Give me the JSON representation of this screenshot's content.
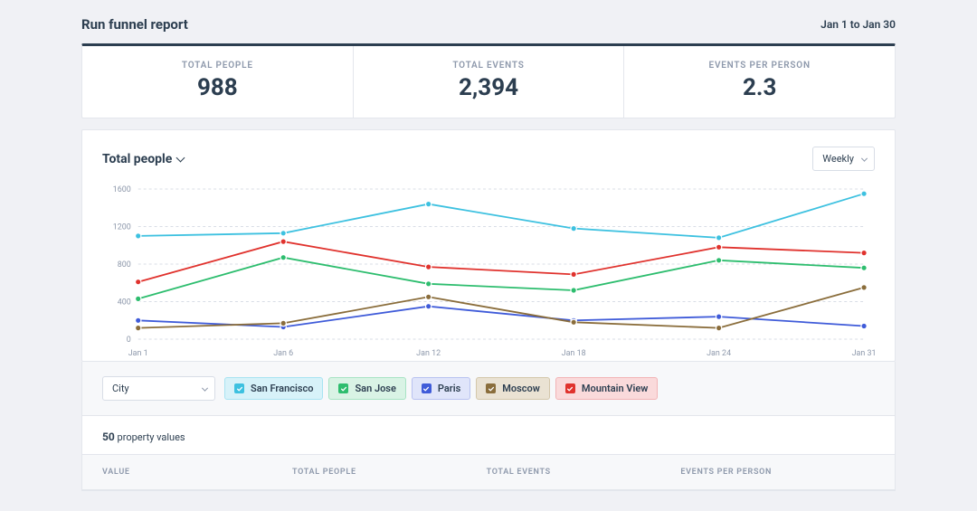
{
  "header": {
    "title": "Run funnel report",
    "date_range": "Jan 1 to Jan 30"
  },
  "stats": [
    {
      "label": "TOTAL PEOPLE",
      "value": "988"
    },
    {
      "label": "TOTAL EVENTS",
      "value": "2,394"
    },
    {
      "label": "EVENTS PER PERSON",
      "value": "2.3"
    }
  ],
  "chart_head": {
    "metric": "Total people",
    "period": "Weekly"
  },
  "filter": {
    "dimension": "City"
  },
  "legend": [
    {
      "name": "San Francisco",
      "color": "#3dc1e0",
      "bg": "#d7f2f9",
      "border": "#a8e3f2"
    },
    {
      "name": "San Jose",
      "color": "#2dbd6e",
      "bg": "#d9f3e5",
      "border": "#a8e3c4"
    },
    {
      "name": "Paris",
      "color": "#3f5bd9",
      "bg": "#e0e5fa",
      "border": "#b8c2f0"
    },
    {
      "name": "Moscow",
      "color": "#8a6d3b",
      "bg": "#eae2d3",
      "border": "#d4c7ab"
    },
    {
      "name": "Mountain View",
      "color": "#e0322d",
      "bg": "#fadadb",
      "border": "#f2b4b6"
    }
  ],
  "property_summary": {
    "count": "50",
    "label": "property values"
  },
  "table_columns": [
    "VALUE",
    "TOTAL PEOPLE",
    "TOTAL EVENTS",
    "EVENTS PER PERSON"
  ],
  "chart_data": {
    "type": "line",
    "title": "Total people",
    "xlabel": "",
    "ylabel": "",
    "ylim": [
      0,
      1600
    ],
    "categories": [
      "Jan 1",
      "Jan 6",
      "Jan 12",
      "Jan 18",
      "Jan 24",
      "Jan 31"
    ],
    "y_ticks": [
      0,
      400,
      800,
      1200,
      1600
    ],
    "series": [
      {
        "name": "San Francisco",
        "color": "#3dc1e0",
        "values": [
          1100,
          1130,
          1440,
          1180,
          1080,
          1550
        ]
      },
      {
        "name": "San Jose",
        "color": "#2dbd6e",
        "values": [
          430,
          870,
          590,
          520,
          840,
          760
        ]
      },
      {
        "name": "Paris",
        "color": "#3f5bd9",
        "values": [
          200,
          130,
          350,
          200,
          240,
          140
        ]
      },
      {
        "name": "Moscow",
        "color": "#8a6d3b",
        "values": [
          120,
          170,
          450,
          180,
          120,
          550
        ]
      },
      {
        "name": "Mountain View",
        "color": "#e0322d",
        "values": [
          610,
          1040,
          770,
          690,
          980,
          920
        ]
      }
    ]
  }
}
